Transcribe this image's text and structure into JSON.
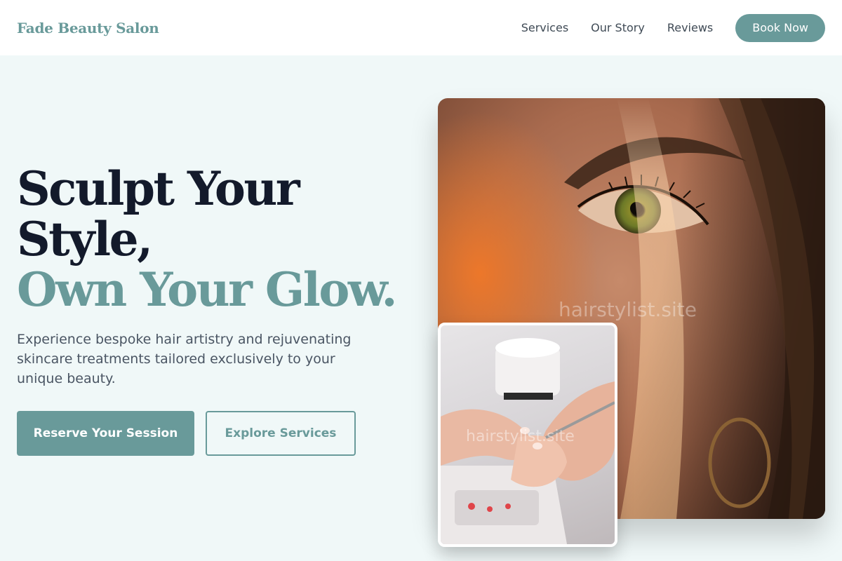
{
  "header": {
    "brand": "Fade Beauty Salon",
    "nav": [
      "Services",
      "Our Story",
      "Reviews"
    ],
    "cta": "Book Now"
  },
  "hero": {
    "title_line1": "Sculpt Your",
    "title_line2": "Style,",
    "title_line3": "Own Your Glow.",
    "subtitle": "Experience bespoke hair artistry and rejuvenating skincare treatments tailored exclusively to your unique beauty.",
    "primary_cta": "Reserve Your Session",
    "secondary_cta": "Explore Services"
  },
  "images": {
    "main_watermark": "hairstylist.site",
    "inset_watermark": "hairstylist.site"
  },
  "colors": {
    "accent": "#699a9a",
    "heading": "#131a2b",
    "background": "#f0f8f8"
  }
}
